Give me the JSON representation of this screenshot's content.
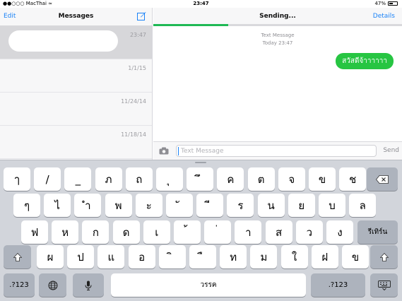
{
  "status_bar": {
    "carrier": "MacThai",
    "time": "23:47",
    "battery": "47%"
  },
  "sidebar": {
    "edit_label": "Edit",
    "title": "Messages",
    "conversations": [
      {
        "date": "23:47"
      },
      {
        "date": "1/1/15"
      },
      {
        "date": "11/24/14"
      },
      {
        "date": "11/18/14"
      }
    ]
  },
  "thread": {
    "title": "Sending...",
    "details_label": "Details",
    "meta_type": "Text Message",
    "meta_time": "Today 23:47",
    "message": "สวัสดีจ้าาาาาา",
    "send_progress": 0.3
  },
  "input": {
    "placeholder": "Text Message",
    "send_label": "Send"
  },
  "keyboard": {
    "row1": [
      "ๅ",
      "/",
      "_",
      "ภ",
      "ถ",
      "ุ",
      "ึ",
      "ค",
      "ต",
      "จ",
      "ข",
      "ช"
    ],
    "row2": [
      "ๆ",
      "ไ",
      "ำ",
      "พ",
      "ะ",
      "ั",
      "ี",
      "ร",
      "น",
      "ย",
      "บ",
      "ล"
    ],
    "row3": [
      "ฟ",
      "ห",
      "ก",
      "ด",
      "เ",
      "้",
      "่",
      "า",
      "ส",
      "ว",
      "ง"
    ],
    "return_label": "รีเทิร์น",
    "row4": [
      "ผ",
      "ป",
      "แ",
      "อ",
      "ิ",
      "ื",
      "ท",
      "ม",
      "ใ",
      "ฝ",
      "ข"
    ],
    "numbers_label": ".?123",
    "space_label": "วรรค"
  },
  "colors": {
    "accent": "#1a82f7",
    "bubble": "#27c542",
    "progress": "#1fb955"
  }
}
